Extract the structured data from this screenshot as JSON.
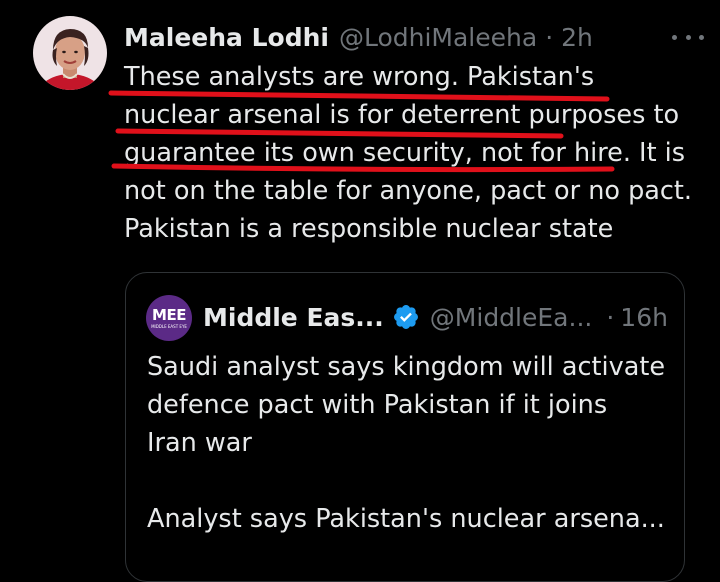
{
  "tweet": {
    "author_name": "Maleeha Lodhi",
    "author_handle": "@LodhiMaleeha",
    "separator": "·",
    "time": "2h",
    "lines": [
      "These analysts are wrong. Pakistan's",
      "nuclear arsenal is for deterrent purposes to",
      "guarantee its own security, not for hire. It is",
      "not on the table for anyone, pact or no pact.",
      "Pakistan is a responsible nuclear state"
    ],
    "avatar_icon": "person-avatar",
    "more_icon": "more-horizontal-icon",
    "annotation_color": "#e0101a"
  },
  "quote": {
    "author_name": "Middle Eas...",
    "verified_icon": "verified-badge-icon",
    "verified_color": "#1d9bf0",
    "author_handle": "@MiddleEa...",
    "separator": "·",
    "time": "16h",
    "logo_text": "MEE",
    "logo_subtext": "MIDDLE EAST EYE",
    "logo_color": "#5b2a86",
    "headline_lines": [
      "Saudi analyst says kingdom will activate",
      "defence pact with Pakistan if it joins",
      "Iran war"
    ],
    "summary_line": "Analyst says Pakistan's nuclear arsena..."
  },
  "colors": {
    "background": "#000000",
    "text": "#e7e9ea",
    "muted": "#71767b",
    "border": "#2f3336"
  }
}
